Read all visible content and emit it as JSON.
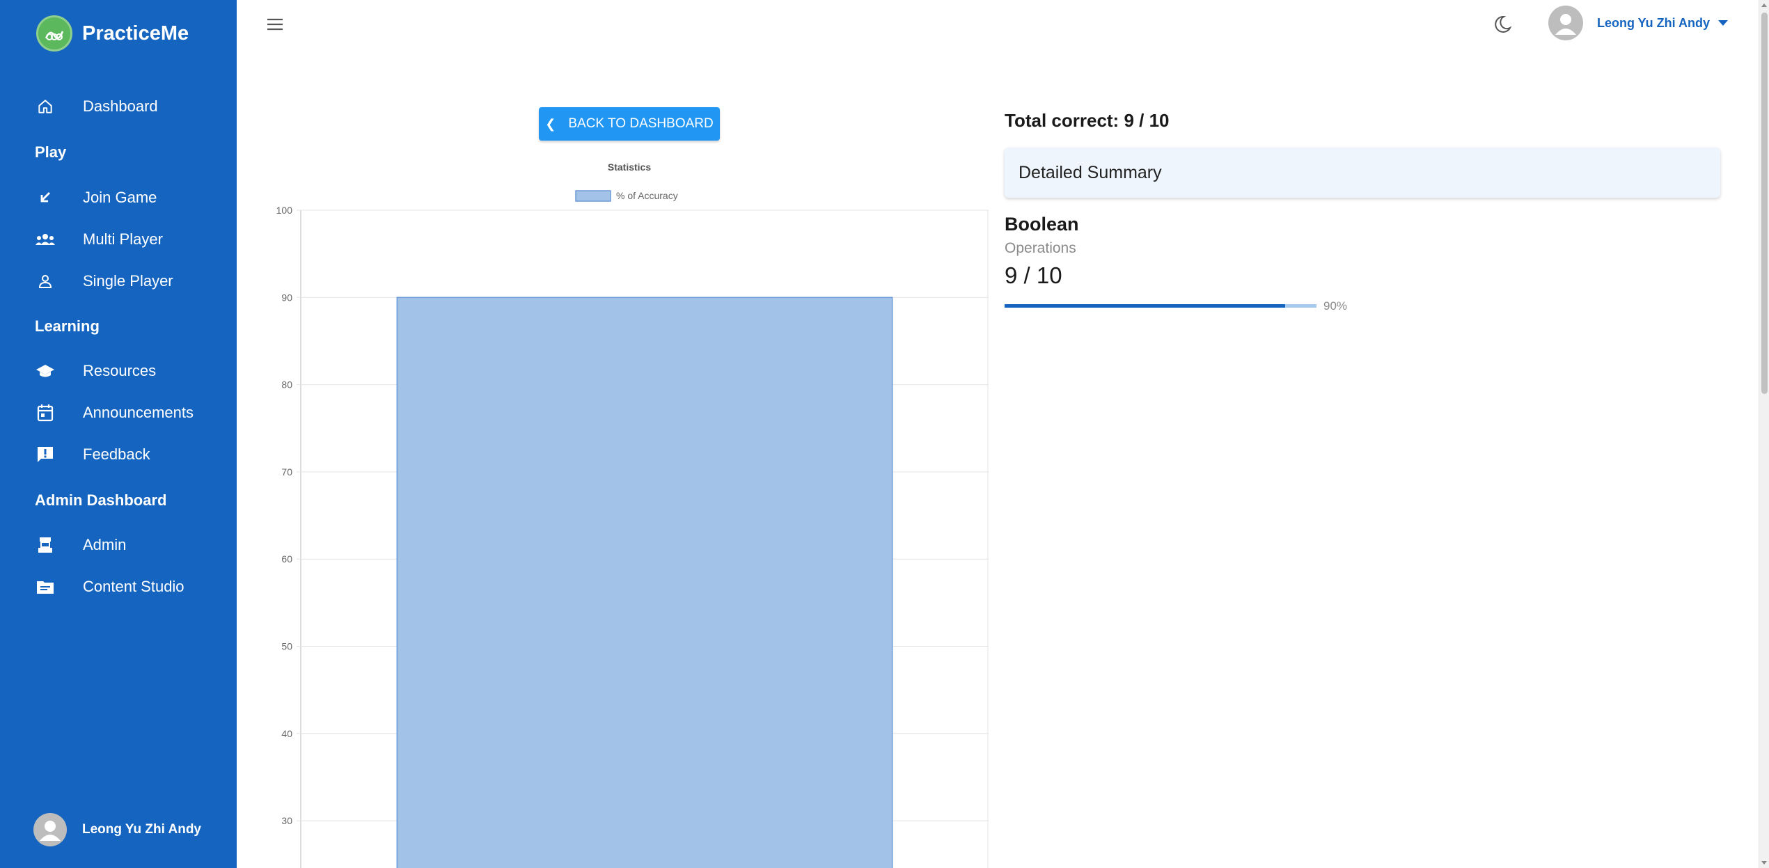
{
  "app": {
    "name": "PracticeMe"
  },
  "sidebar": {
    "items": [
      {
        "label": "Dashboard",
        "icon": "home-icon"
      },
      {
        "label": "Join Game",
        "icon": "arrow-down-left-icon"
      },
      {
        "label": "Multi Player",
        "icon": "group-icon"
      },
      {
        "label": "Single Player",
        "icon": "person-icon"
      },
      {
        "label": "Resources",
        "icon": "school-icon"
      },
      {
        "label": "Announcements",
        "icon": "calendar-icon"
      },
      {
        "label": "Feedback",
        "icon": "feedback-icon"
      },
      {
        "label": "Admin",
        "icon": "admin-icon"
      },
      {
        "label": "Content Studio",
        "icon": "folder-icon"
      }
    ],
    "sections": {
      "play": "Play",
      "learning": "Learning",
      "admin": "Admin Dashboard"
    },
    "user_name": "Leong Yu Zhi Andy"
  },
  "topbar": {
    "user_name": "Leong Yu Zhi Andy"
  },
  "main": {
    "back_button": "BACK TO DASHBOARD",
    "total_correct": "Total correct: 9 / 10",
    "summary_title": "Detailed Summary",
    "topic": "Boolean",
    "subtopic": "Operations",
    "score": "9 / 10",
    "progress_percent": 90,
    "progress_label": "90%"
  },
  "colors": {
    "sidebar": "#1565c0",
    "accent": "#2196f3",
    "bar_fill": "#a3c2e8",
    "bar_border": "#6b9ad8"
  },
  "chart_data": {
    "type": "bar",
    "title": "Statistics",
    "legend": "% of Accuracy",
    "legend_position": "top",
    "categories": [
      ""
    ],
    "series": [
      {
        "name": "% of Accuracy",
        "values": [
          90
        ]
      }
    ],
    "y_ticks": [
      "100",
      "90",
      "80",
      "70",
      "60",
      "50",
      "40",
      "30"
    ],
    "ylim": [
      0,
      100
    ],
    "grid": true
  }
}
